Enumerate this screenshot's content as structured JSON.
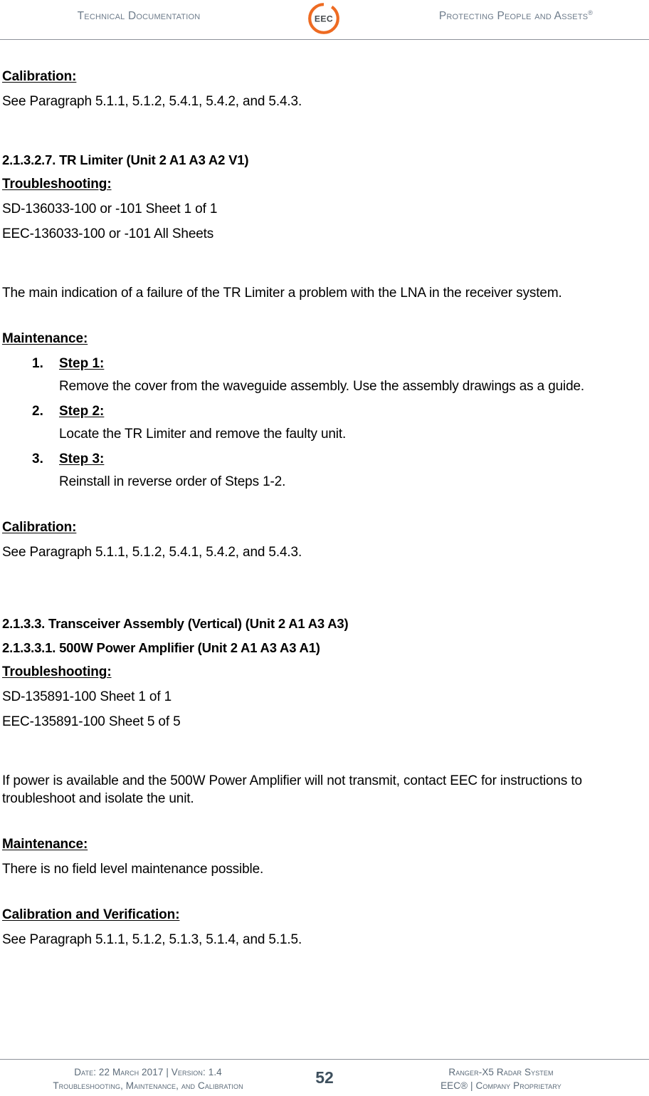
{
  "header": {
    "left_text": "Technical Documentation",
    "logo": {
      "name": "eec-logo",
      "wordmark": "EEC",
      "ring_color": "#EE6B22",
      "text_color": "#44484b"
    },
    "right_text": "Protecting People and Assets",
    "right_text_sup": "®"
  },
  "body": {
    "block1": {
      "heading": "Calibration:",
      "text": "See Paragraph 5.1.1, 5.1.2, 5.4.1, 5.4.2, and 5.4.3."
    },
    "section_2_1_3_2_7": {
      "heading": "2.1.3.2.7.   TR Limiter (Unit 2 A1 A3 A2 V1)",
      "troubleshooting_label": "Troubleshooting:",
      "ref1": "SD-136033-100 or -101 Sheet 1 of 1",
      "ref2": "EEC-136033-100 or -101 All Sheets",
      "description": "The main indication of a failure of the TR Limiter a problem with the LNA in the receiver system.",
      "maintenance_label": "Maintenance:",
      "steps": [
        {
          "num": "1.",
          "title": "Step 1:",
          "body": "Remove the cover from the waveguide assembly.  Use the assembly drawings as a guide."
        },
        {
          "num": "2.",
          "title": "Step 2:",
          "body": "Locate the TR Limiter and remove the faulty unit."
        },
        {
          "num": "3.",
          "title": "Step 3:",
          "body": "Reinstall in reverse order of Steps 1-2."
        }
      ],
      "calibration_label": "Calibration:",
      "calibration_text": "See Paragraph 5.1.1, 5.1.2, 5.4.1, 5.4.2, and 5.4.3."
    },
    "section_2_1_3_3": {
      "heading": "2.1.3.3.    Transceiver Assembly (Vertical) (Unit 2 A1 A3 A3)"
    },
    "section_2_1_3_3_1": {
      "heading": "2.1.3.3.1.   500W Power Amplifier (Unit 2 A1 A3 A3 A1)",
      "troubleshooting_label": "Troubleshooting:",
      "ref1": "SD-135891-100 Sheet 1 of 1",
      "ref2": "EEC-135891-100 Sheet 5 of 5",
      "description": "If power is available and the 500W Power Amplifier will not transmit, contact EEC for instructions to troubleshoot and isolate the unit.",
      "maintenance_label": "Maintenance:",
      "maintenance_text": "There is no field level maintenance possible.",
      "calibration_label": "Calibration and Verification:",
      "calibration_text": "See Paragraph 5.1.1, 5.1.2, 5.1.3, 5.1.4, and 5.1.5."
    }
  },
  "footer": {
    "left_line1": "Date: 22 March 2017 | Version: 1.4",
    "left_line2": "Troubleshooting, Maintenance, and Calibration",
    "page_number": "52",
    "right_line1": "Ranger-X5 Radar System",
    "right_line2": "EEC® | Company Proprietary"
  }
}
